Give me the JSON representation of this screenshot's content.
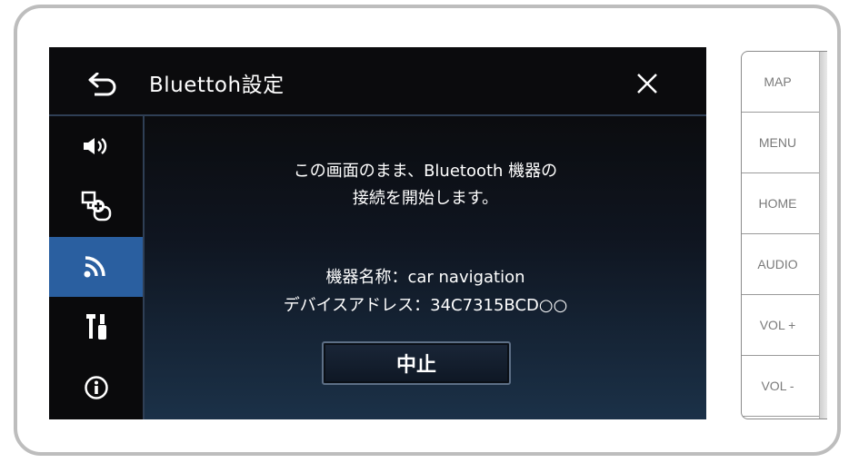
{
  "header": {
    "title": "Bluettoh設定"
  },
  "sidebar": {
    "items": [
      {
        "name": "sound",
        "icon": "speaker-icon"
      },
      {
        "name": "device",
        "icon": "device-connect-icon"
      },
      {
        "name": "bluetooth",
        "icon": "signal-icon",
        "active": true
      },
      {
        "name": "tools",
        "icon": "tools-icon"
      },
      {
        "name": "info",
        "icon": "info-icon"
      }
    ]
  },
  "content": {
    "message_line1": "この画面のまま、Bluetooth 機器の",
    "message_line2": "接続を開始します。",
    "device_name": "機器名称：car navigation",
    "device_address": "デバイスアドレス：34C7315BCD○○",
    "cancel_label": "中止"
  },
  "hardware_buttons": {
    "map": "MAP",
    "menu": "MENU",
    "home": "HOME",
    "audio": "AUDIO",
    "vol_up": "VOL +",
    "vol_down": "VOL -"
  },
  "colors": {
    "active_sidebar": "#2a5fa0",
    "screen_bg": "#0b0b0d",
    "bezel": "#bdbdbd"
  }
}
